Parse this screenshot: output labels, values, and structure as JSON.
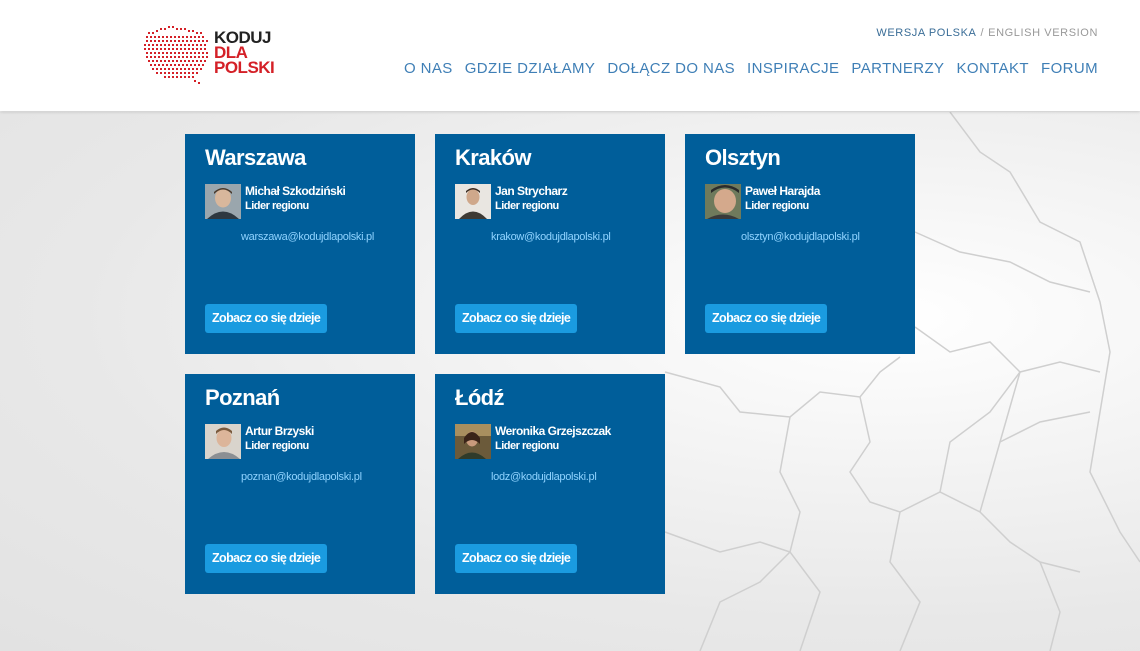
{
  "logo": {
    "line1": "KODUJ",
    "line2": "DLA",
    "line3": "POLSKI",
    "colors": {
      "dark": "#222222",
      "red": "#d42027"
    }
  },
  "language": {
    "active": "WERSJA POLSKA",
    "separator": "/",
    "inactive": "ENGLISH VERSION"
  },
  "nav": {
    "items": [
      "O NAS",
      "GDZIE DZIAŁAMY",
      "DOŁĄCZ DO NAS",
      "INSPIRACJE",
      "PARTNERZY",
      "KONTAKT",
      "FORUM"
    ]
  },
  "colors": {
    "card_bg": "#005e9a",
    "button_bg": "#1a9be0",
    "email": "#8fd3ff",
    "nav": "#3f7fb6"
  },
  "cards": [
    {
      "city": "Warszawa",
      "name": "Michał Szkodziński",
      "role": "Lider regionu",
      "email": "warszawa@kodujdlapolski.pl",
      "button": "Zobacz co się dzieje",
      "avatar_icon": "person-avatar"
    },
    {
      "city": "Kraków",
      "name": "Jan Strycharz",
      "role": "Lider regionu",
      "email": "krakow@kodujdlapolski.pl",
      "button": "Zobacz co się dzieje",
      "avatar_icon": "person-avatar"
    },
    {
      "city": "Olsztyn",
      "name": "Paweł Harajda",
      "role": "Lider regionu",
      "email": "olsztyn@kodujdlapolski.pl",
      "button": "Zobacz co się dzieje",
      "avatar_icon": "person-avatar"
    },
    {
      "city": "Poznań",
      "name": "Artur Brzyski",
      "role": "Lider regionu",
      "email": "poznan@kodujdlapolski.pl",
      "button": "Zobacz co się dzieje",
      "avatar_icon": "person-avatar"
    },
    {
      "city": "Łódź",
      "name": "Weronika Grzejszczak",
      "role": "Lider regionu",
      "email": "lodz@kodujdlapolski.pl",
      "button": "Zobacz co się dzieje",
      "avatar_icon": "person-avatar"
    }
  ]
}
